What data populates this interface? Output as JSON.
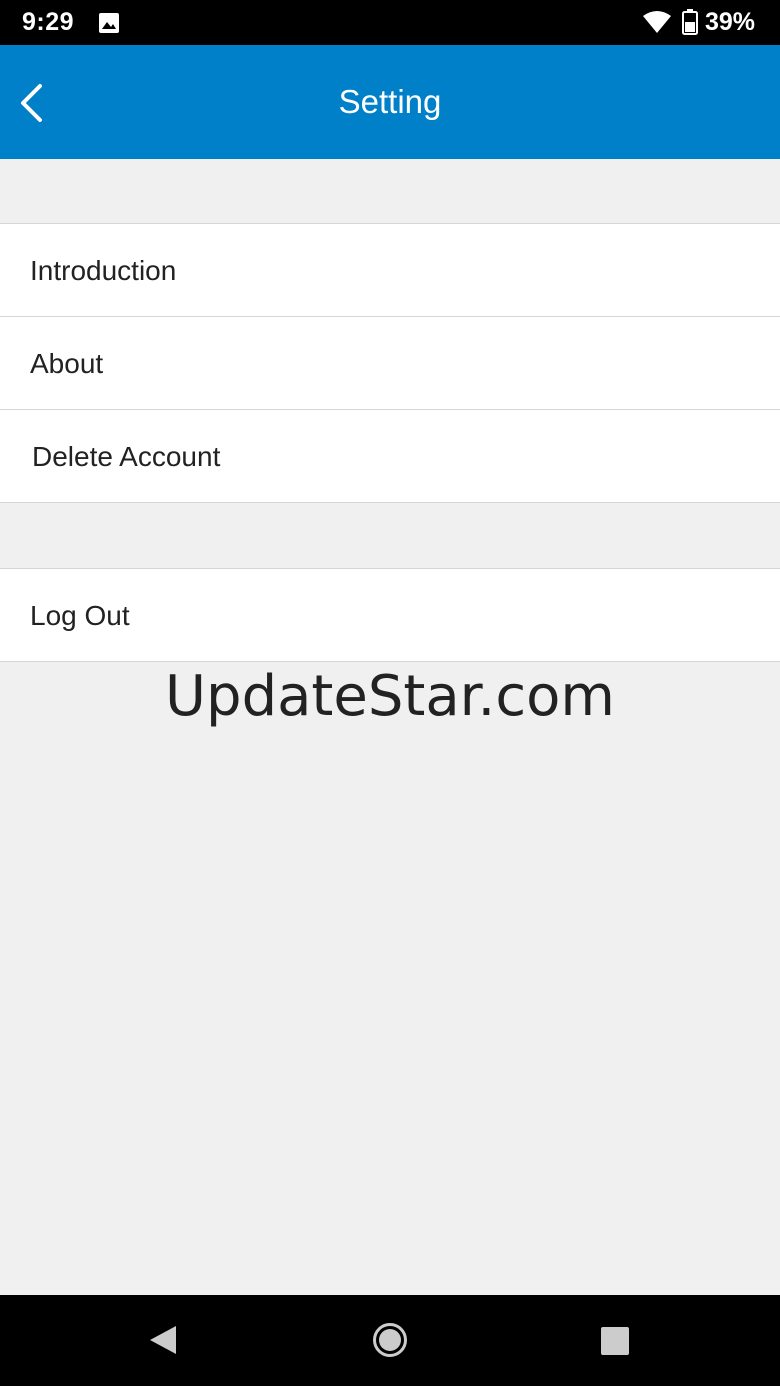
{
  "status_bar": {
    "time": "9:29",
    "battery": "39%",
    "icons": [
      "gallery-icon",
      "wifi-icon",
      "battery-icon"
    ]
  },
  "app_bar": {
    "title": "Setting",
    "back_icon": "chevron-left-icon",
    "color": "#0080c8"
  },
  "menu": {
    "group1": [
      {
        "label": "Introduction"
      },
      {
        "label": "About"
      },
      {
        "label": "Delete Account"
      }
    ],
    "group2": [
      {
        "label": "Log Out"
      }
    ]
  },
  "watermark": "UpdateStar.com",
  "nav_bar": {
    "icons": [
      "back-triangle-icon",
      "home-circle-icon",
      "recents-square-icon"
    ]
  }
}
